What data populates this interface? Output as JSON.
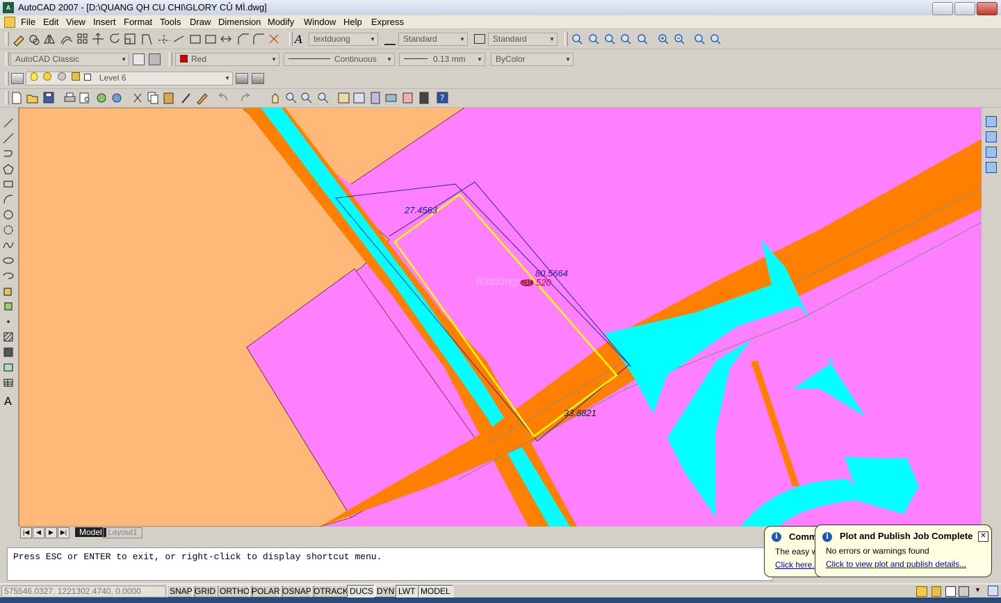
{
  "window": {
    "title": "AutoCAD 2007 - [D:\\QUANG QH CU CHI\\GLORY CỦ MÌ.dwg]",
    "app_icon": "acad-icon"
  },
  "menu": [
    "File",
    "Edit",
    "View",
    "Insert",
    "Format",
    "Tools",
    "Draw",
    "Dimension",
    "Modify",
    "Window",
    "Help",
    "Express"
  ],
  "styles": {
    "text_style": "textduong",
    "dim_style": "Standard",
    "table_style": "Standard"
  },
  "workspace": "AutoCAD Classic",
  "properties": {
    "color": "Red",
    "color_hex": "#cc0000",
    "linetype": "Continuous",
    "lineweight": "0.13 mm",
    "plotstyle": "ByColor"
  },
  "layer": {
    "name": "Level 6"
  },
  "drawing": {
    "dimensions": [
      "27.4563",
      "80.5664",
      "33.8821"
    ],
    "lot_label": "520",
    "watermark": "Batdongsan",
    "colors": {
      "residential": "#ff80ff",
      "agricultural": "#ffb877",
      "road": "#ff7f00",
      "water": "#00ffff",
      "lot_boundary": "#ffff00",
      "dim_line": "#1a1aa0"
    }
  },
  "tabs": {
    "model": "Model",
    "layout1": "Layout1"
  },
  "command": {
    "text": "Press ESC or ENTER to exit, or right-click to display shortcut menu."
  },
  "status": {
    "coordinates": "575546.0327, 1221302.4740, 0.0000",
    "toggles": [
      "SNAP",
      "GRID",
      "ORTHO",
      "POLAR",
      "OSNAP",
      "OTRACK",
      "DUCS",
      "DYN",
      "LWT",
      "MODEL"
    ]
  },
  "notifications": {
    "comm": {
      "title": "Comm",
      "text": "The easy wa",
      "link": "Click here."
    },
    "plot": {
      "title": "Plot and Publish Job Complete",
      "text": "No errors or warnings found",
      "link": "Click to view plot and publish details..."
    }
  }
}
